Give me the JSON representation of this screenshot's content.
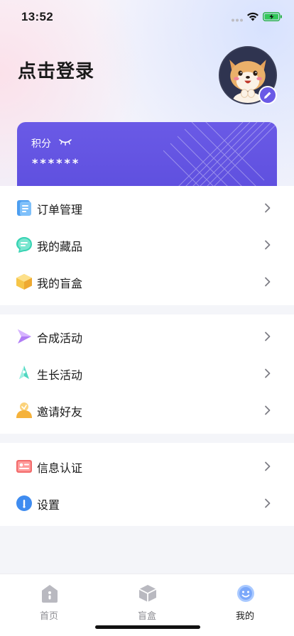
{
  "status_bar": {
    "time": "13:52"
  },
  "header": {
    "login_title": "点击登录",
    "avatar_icon": "dog-avatar-icon",
    "edit_icon": "pencil-icon"
  },
  "points_card": {
    "label": "积分",
    "eye_icon": "eye-closed-icon",
    "value": "******",
    "color": "#6a5ae6"
  },
  "menu_groups": [
    {
      "items": [
        {
          "label": "订单管理",
          "icon": "order-list-icon"
        },
        {
          "label": "我的藏品",
          "icon": "collection-icon"
        },
        {
          "label": "我的盲盒",
          "icon": "box-icon"
        }
      ]
    },
    {
      "items": [
        {
          "label": "合成活动",
          "icon": "synthesis-arrow-icon"
        },
        {
          "label": "生长活动",
          "icon": "growth-rocket-icon"
        },
        {
          "label": "邀请好友",
          "icon": "invite-friend-icon"
        }
      ]
    },
    {
      "items": [
        {
          "label": "信息认证",
          "icon": "id-card-icon"
        },
        {
          "label": "设置",
          "icon": "settings-icon"
        }
      ]
    }
  ],
  "tab_bar": {
    "tabs": [
      {
        "label": "首页",
        "icon": "home-icon",
        "active": false
      },
      {
        "label": "盲盒",
        "icon": "blind-box-icon",
        "active": false
      },
      {
        "label": "我的",
        "icon": "profile-smile-icon",
        "active": true
      }
    ]
  }
}
